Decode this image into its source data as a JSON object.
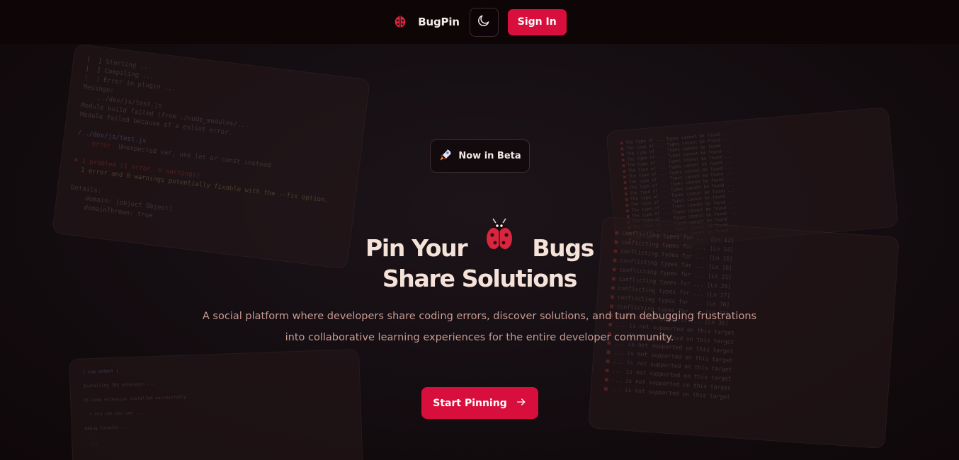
{
  "header": {
    "brand_name": "BugPin",
    "logo_icon": "ladybug-icon",
    "theme_toggle_icon": "moon-icon",
    "signin_label": "Sign In"
  },
  "hero": {
    "badge_icon": "rocket-icon",
    "badge_label": "Now in Beta",
    "title_word_1": "Pin Your",
    "title_word_2": "Bugs",
    "title_icon": "ladybug-icon",
    "title_line_2": "Share Solutions",
    "subtitle": "A social platform where developers share coding errors, discover solutions, and turn debugging frustrations into collaborative learning experiences for the entire developer community.",
    "cta_label": "Start Pinning",
    "cta_icon": "arrow-right-icon"
  },
  "colors": {
    "accent": "#d80f3c",
    "background": "#110a0c",
    "title": "#f5e3da",
    "subtitle": "#c79a92"
  }
}
